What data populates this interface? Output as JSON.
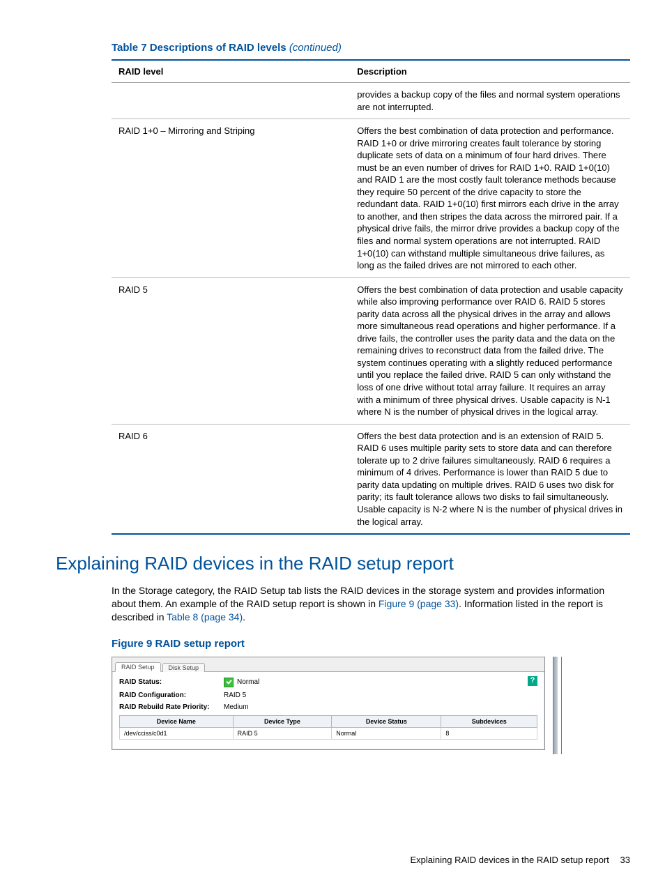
{
  "table": {
    "caption_main": "Table 7 Descriptions of RAID levels",
    "caption_cont": "(continued)",
    "headers": {
      "level": "RAID level",
      "desc": "Description"
    },
    "rows": [
      {
        "level": "",
        "desc": "provides a backup copy of the files and normal system operations are not interrupted."
      },
      {
        "level": "RAID 1+0 – Mirroring and Striping",
        "desc": "Offers the best combination of data protection and performance. RAID 1+0 or drive mirroring creates fault tolerance by storing duplicate sets of data on a minimum of four hard drives. There must be an even number of drives for RAID 1+0. RAID 1+0(10) and RAID 1 are the most costly fault tolerance methods because they require 50 percent of the drive capacity to store the redundant data. RAID 1+0(10) first mirrors each drive in the array to another, and then stripes the data across the mirrored pair. If a physical drive fails, the mirror drive provides a backup copy of the files and normal system operations are not interrupted. RAID 1+0(10) can withstand multiple simultaneous drive failures, as long as the failed drives are not mirrored to each other."
      },
      {
        "level": "RAID 5",
        "desc": "Offers the best combination of data protection and usable capacity while also improving performance over RAID 6. RAID 5 stores parity data across all the physical drives in the array and allows more simultaneous read operations and higher performance. If a drive fails, the controller uses the parity data and the data on the remaining drives to reconstruct data from the failed drive. The system continues operating with a slightly reduced performance until you replace the failed drive. RAID 5 can only withstand the loss of one drive without total array failure. It requires an array with a minimum of three physical drives. Usable capacity is N-1 where N is the number of physical drives in the logical array."
      },
      {
        "level": "RAID 6",
        "desc": "Offers the best data protection and is an extension of RAID 5. RAID 6 uses multiple parity sets to store data and can therefore tolerate up to 2 drive failures simultaneously. RAID 6 requires a minimum of 4 drives. Performance is lower than RAID 5 due to parity data updating on multiple drives. RAID 6 uses two disk for parity; its fault tolerance allows two disks to fail simultaneously. Usable capacity is N-2 where N is the number of physical drives in the logical array."
      }
    ]
  },
  "section": {
    "heading": "Explaining RAID devices in the RAID setup report",
    "body_pre": "In the Storage category, the RAID Setup tab lists the RAID devices in the storage system and provides information about them. An example of the RAID setup report is shown in ",
    "link1": "Figure 9 (page 33)",
    "body_mid": ". Information listed in the report is described in ",
    "link2": "Table 8 (page 34)",
    "body_post": "."
  },
  "figure": {
    "caption": "Figure 9 RAID setup report",
    "tabs": {
      "active": "RAID Setup",
      "other": "Disk Setup"
    },
    "status_label": "RAID Status:",
    "status_value": "Normal",
    "config_label": "RAID Configuration:",
    "config_value": "RAID 5",
    "priority_label": "RAID Rebuild Rate Priority:",
    "priority_value": "Medium",
    "help_badge": "?",
    "dev_headers": {
      "name": "Device Name",
      "type": "Device Type",
      "status": "Device Status",
      "sub": "Subdevices"
    },
    "dev_row": {
      "name": "/dev/cciss/c0d1",
      "type": "RAID 5",
      "status": "Normal",
      "sub": "8"
    }
  },
  "footer": {
    "text": "Explaining RAID devices in the RAID setup report",
    "page": "33"
  }
}
